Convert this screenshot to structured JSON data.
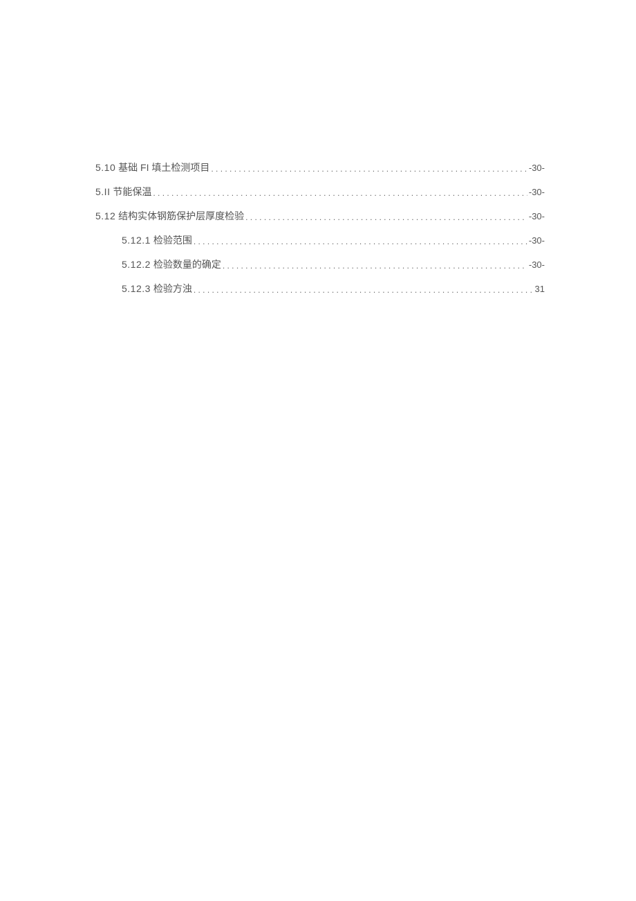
{
  "toc": {
    "entries": [
      {
        "num": "5.10",
        "title": " 基础 FI 填土检测项目 ",
        "page": "-30-",
        "indent": false
      },
      {
        "num": "5.II",
        "title": " 节能保温",
        "page": "-30-",
        "indent": false
      },
      {
        "num": "5.12",
        "title": " 结构实体钢筋保护层厚度检验",
        "page": "-30-",
        "indent": false
      },
      {
        "num": "5.12.1",
        "title": " 检验范围 ",
        "page": "-30-",
        "indent": true
      },
      {
        "num": "5.12.2",
        "title": " 检验数量的确定 ",
        "page": "-30-",
        "indent": true
      },
      {
        "num": "5.12.3",
        "title": " 检验方浊",
        "page": "31",
        "indent": true
      }
    ]
  }
}
